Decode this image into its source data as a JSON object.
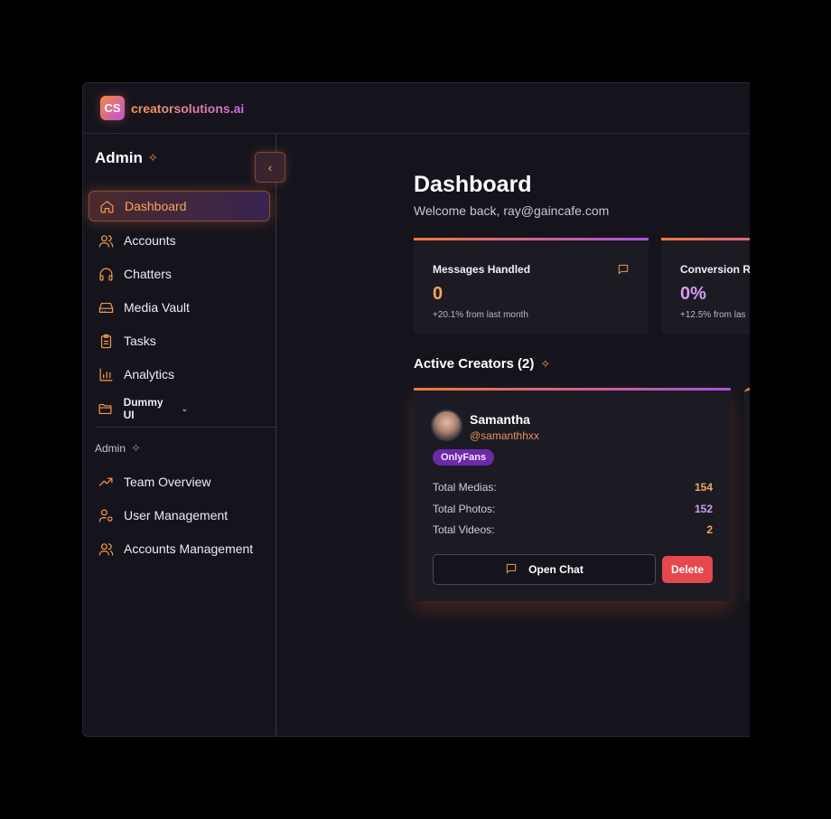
{
  "brand": {
    "mark": "CS",
    "name": "creatorsolutions.ai"
  },
  "sidebar": {
    "title": "Admin",
    "items": [
      {
        "label": "Dashboard",
        "icon": "home-icon",
        "active": true
      },
      {
        "label": "Accounts",
        "icon": "users-icon"
      },
      {
        "label": "Chatters",
        "icon": "headphones-icon"
      },
      {
        "label": "Media Vault",
        "icon": "hard-drive-icon"
      },
      {
        "label": "Tasks",
        "icon": "clipboard-icon"
      },
      {
        "label": "Analytics",
        "icon": "bar-chart-icon"
      },
      {
        "label": "Dummy UI",
        "icon": "folder-icon"
      }
    ],
    "section_label": "Admin",
    "admin_items": [
      {
        "label": "Team Overview",
        "icon": "trending-up-icon"
      },
      {
        "label": "User Management",
        "icon": "user-cog-icon"
      },
      {
        "label": "Accounts Management",
        "icon": "users-icon"
      }
    ]
  },
  "main": {
    "title": "Dashboard",
    "welcome": "Welcome back, ray@gaincafe.com",
    "stats": [
      {
        "label": "Messages Handled",
        "value": "0",
        "change": "+20.1% from last month",
        "value_color": "#f5a65a"
      },
      {
        "label": "Conversion Ra",
        "value": "0%",
        "change": "+12.5% from las",
        "value_color": "#d49af5"
      }
    ],
    "active_creators_title": "Active Creators (2)",
    "creators": [
      {
        "name": "Samantha",
        "handle": "@samanthhxx",
        "platform": "OnlyFans",
        "rows": [
          {
            "label": "Total Medias:",
            "value": "154",
            "color": "#f5a65a"
          },
          {
            "label": "Total Photos:",
            "value": "152",
            "color": "#c8a0f5"
          },
          {
            "label": "Total Videos:",
            "value": "2",
            "color": "#f5a65a"
          }
        ],
        "open_chat": "Open Chat",
        "delete": "Delete"
      }
    ]
  },
  "colors": {
    "accent": "#f59a4a",
    "purple": "#b04ee0",
    "danger": "#e5484d",
    "bg": "#15141d",
    "card": "#1c1b24"
  }
}
